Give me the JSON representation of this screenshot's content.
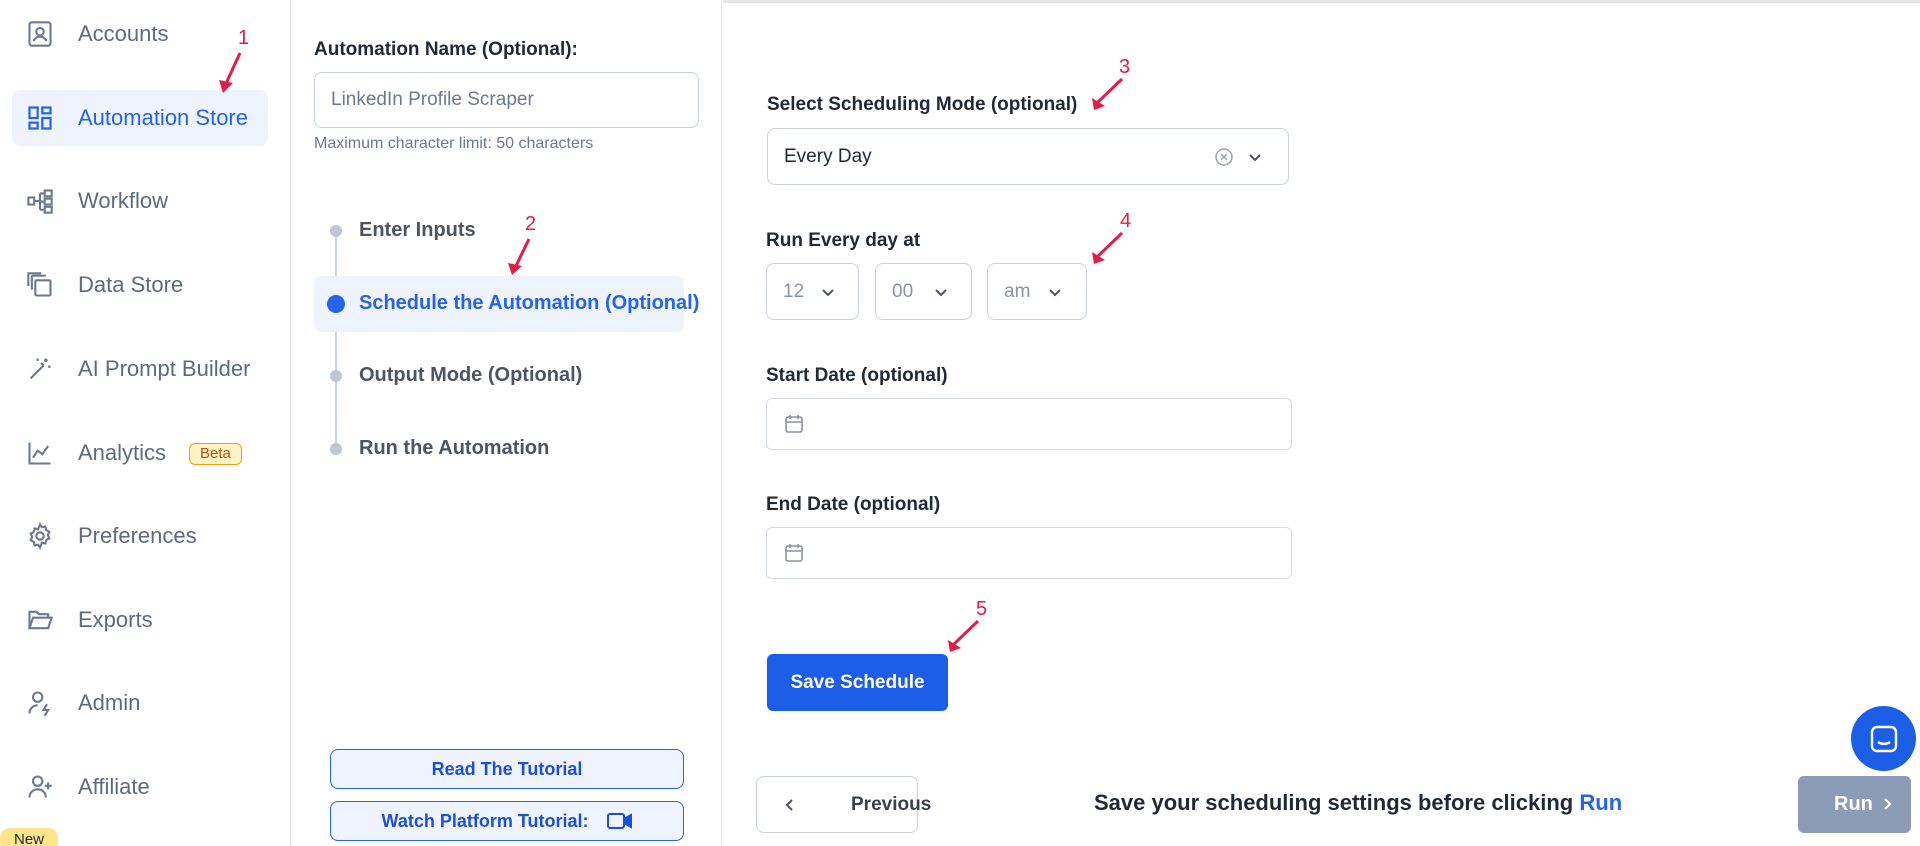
{
  "sidebar": {
    "items": [
      {
        "label": "Accounts",
        "icon": "account-icon"
      },
      {
        "label": "Automation Store",
        "icon": "dashboard-grid-icon",
        "active": true
      },
      {
        "label": "Workflow",
        "icon": "workflow-icon"
      },
      {
        "label": "Data Store",
        "icon": "copy-stack-icon"
      },
      {
        "label": "AI Prompt Builder",
        "icon": "magic-wand-icon"
      },
      {
        "label": "Analytics",
        "icon": "line-chart-icon",
        "badge": "Beta"
      },
      {
        "label": "Preferences",
        "icon": "gear-icon"
      },
      {
        "label": "Exports",
        "icon": "folder-open-icon"
      },
      {
        "label": "Admin",
        "icon": "user-admin-icon"
      },
      {
        "label": "Affiliate",
        "icon": "user-plus-icon"
      }
    ],
    "new_badge": "New"
  },
  "automation": {
    "name_label": "Automation Name (Optional):",
    "name_placeholder": "LinkedIn Profile Scraper",
    "helper": "Maximum character limit: 50 characters",
    "steps": [
      {
        "label": "Enter Inputs"
      },
      {
        "label": "Schedule the Automation (Optional)",
        "active": true
      },
      {
        "label": "Output Mode (Optional)"
      },
      {
        "label": "Run the Automation"
      }
    ],
    "tutorial_button": "Read The Tutorial",
    "platform_tutorial_button": "Watch Platform Tutorial:"
  },
  "schedule": {
    "mode_label": "Select Scheduling Mode (optional)",
    "mode_value": "Every Day",
    "run_label": "Run Every day at",
    "hour": "12",
    "minute": "00",
    "ampm": "am",
    "start_label": "Start Date (optional)",
    "end_label": "End Date (optional)",
    "save_button": "Save Schedule"
  },
  "footer": {
    "previous": "Previous",
    "hint_text": "Save your scheduling settings before clicking",
    "hint_accent": "Run",
    "run": "Run"
  },
  "annotations": [
    "1",
    "2",
    "3",
    "4",
    "5"
  ],
  "colors": {
    "accent": "#2563eb",
    "annotation": "#e11d48",
    "run_disabled": "#8c9bb8"
  }
}
